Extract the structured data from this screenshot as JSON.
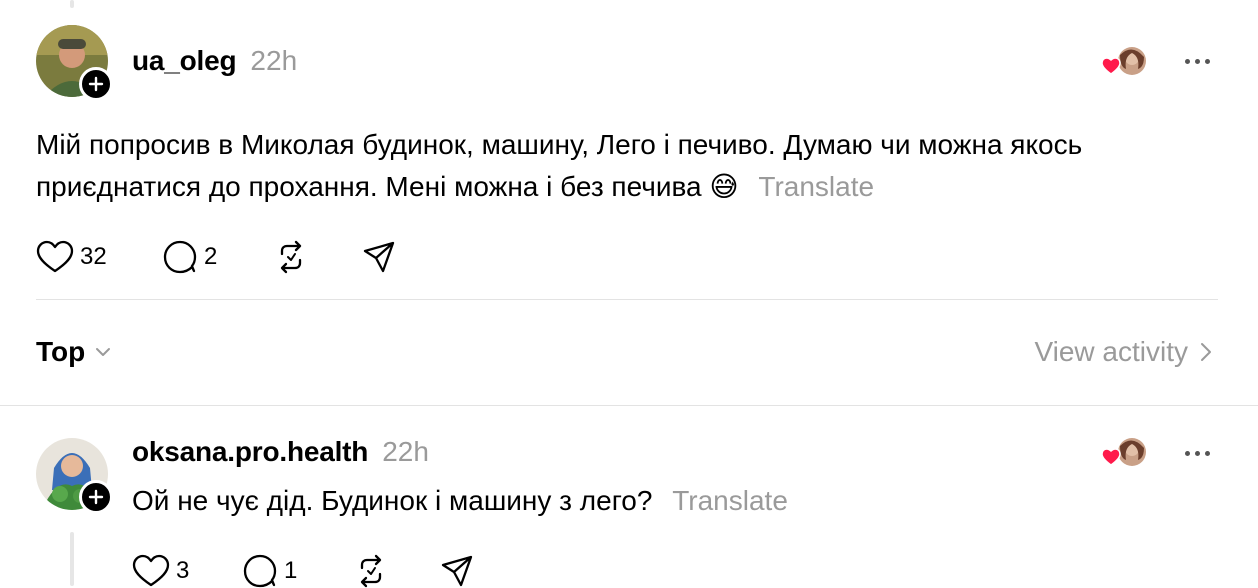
{
  "post": {
    "username": "ua_oleg",
    "time": "22h",
    "text": "Мій попросив в Миколая будинок, машину, Лего і печиво. Думаю чи можна якось приєднатися до прохання. Мені можна і без печива",
    "emoji": "😅",
    "translate": "Translate",
    "likes": "32",
    "replies": "2"
  },
  "sort": {
    "label": "Top",
    "view_activity": "View activity"
  },
  "reply": {
    "username": "oksana.pro.health",
    "time": "22h",
    "text": "Ой не чує дід. Будинок і машину з лего?",
    "translate": "Translate",
    "likes": "3",
    "replies": "1"
  },
  "icons": [
    "heart-icon",
    "comment-icon",
    "repost-icon",
    "share-icon",
    "more-icon",
    "plus-icon",
    "chevron-down-icon",
    "chevron-right-icon"
  ],
  "colors": {
    "like_red": "#ff1a4b",
    "muted": "#9a9a9a",
    "divider": "#e3e3e3"
  }
}
